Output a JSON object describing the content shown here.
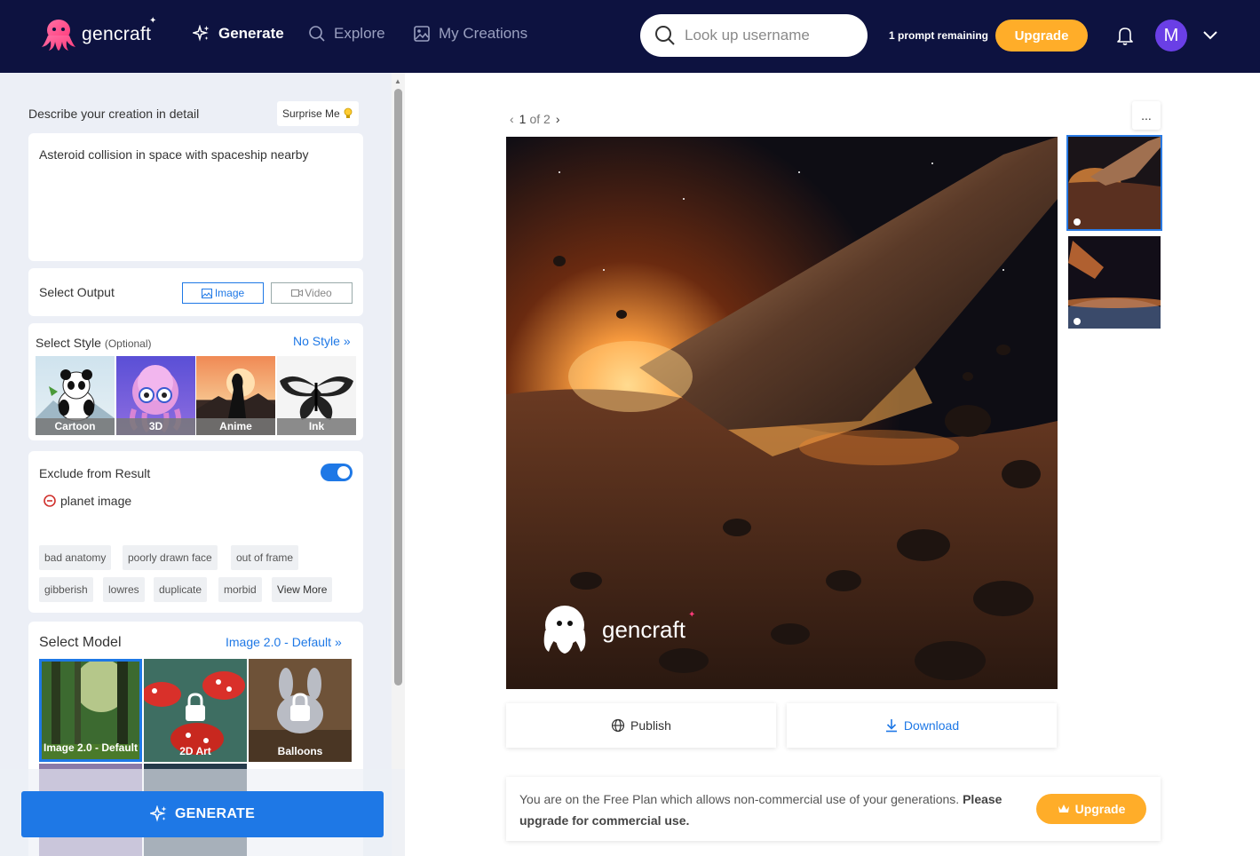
{
  "nav": {
    "logo_text": "gencraft",
    "items": [
      {
        "label": "Generate",
        "icon": "sparkle-icon",
        "active": true
      },
      {
        "label": "Explore",
        "icon": "search-icon",
        "active": false
      },
      {
        "label": "My Creations",
        "icon": "image-icon",
        "active": false
      }
    ],
    "search_placeholder": "Look up username",
    "prompts_remaining": "1 prompt remaining",
    "upgrade_label": "Upgrade",
    "avatar_initial": "M"
  },
  "panel": {
    "describe_label": "Describe your creation in detail",
    "surprise_label": "Surprise Me",
    "prompt_text": "Asteroid collision in space with spaceship nearby",
    "output": {
      "label": "Select Output",
      "options": [
        "Image",
        "Video"
      ],
      "selected": "Image"
    },
    "style": {
      "label": "Select Style",
      "optional": "(Optional)",
      "current": "No Style",
      "tiles": [
        "Cartoon",
        "3D",
        "Anime",
        "Ink"
      ]
    },
    "exclude": {
      "label": "Exclude from Result",
      "enabled": true,
      "custom_item": "planet image",
      "chips": [
        "bad anatomy",
        "poorly drawn face",
        "out of frame",
        "gibberish",
        "lowres",
        "duplicate",
        "morbid"
      ],
      "view_more": "View More"
    },
    "model": {
      "label": "Select Model",
      "current": "Image 2.0 - Default",
      "tiles": [
        {
          "name": "Image 2.0 - Default",
          "locked": false,
          "selected": true
        },
        {
          "name": "2D Art",
          "locked": true,
          "selected": false
        },
        {
          "name": "Balloons",
          "locked": true,
          "selected": false
        }
      ]
    },
    "generate_label": "GENERATE"
  },
  "viewer": {
    "current": "1",
    "pager_suffix": "of 2",
    "more_label": "...",
    "watermark": "gencraft",
    "publish_label": "Publish",
    "download_label": "Download"
  },
  "notice": {
    "text": "You are on the Free Plan which allows non-commercial use of your generations.",
    "bold": "Please upgrade for commercial use.",
    "upgrade_label": "Upgrade"
  },
  "colors": {
    "nav_bg": "#0d1240",
    "accent": "#1e78e6",
    "upgrade": "#ffad29",
    "avatar": "#6a3fe6"
  }
}
